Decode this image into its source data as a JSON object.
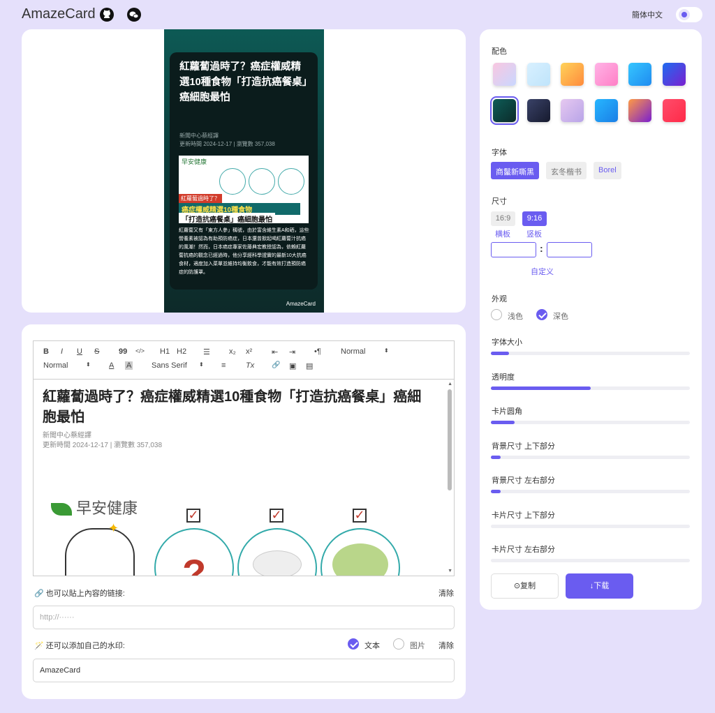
{
  "header": {
    "brand": "AmazeCard",
    "language": "簡体中文",
    "github_icon": "github-icon",
    "wechat_icon": "wechat-icon"
  },
  "preview": {
    "title": "紅蘿蔔過時了？癌症權威精選10種食物「打造抗癌餐桌」癌細胞最怕",
    "author": "新聞中心蔡經譯",
    "updated": "更新時間 2024-12-17 | 瀏覽數 357,038",
    "img_logo": "早安健康",
    "img_cap1": "紅蘿蔔過時了？",
    "img_cap2": "癌症權威精選10種食物",
    "img_cap3": "「打造抗癌餐桌」癌細胞最怕",
    "body": "紅蘿蔔又有「東方人參」稱號，由於富含維生素A和硒，這些營養素被認為有助預防癌症，日本還曾掀起喝紅蘿蔔汁抗癌的風潮！然而，日本癌症專家佐藤典宏教授認為，依賴紅蘿蔔抗癌的觀念已經過時，他分享經科學證實的最新10大抗癌食材，適度加入菜單並維持均衡飲食，才能有效打造預防癌症的防護罩。",
    "watermark": "AmazeCard"
  },
  "editor": {
    "toolbar": {
      "bold": "B",
      "italic": "I",
      "underline": "U",
      "strike": "S",
      "quote": "99",
      "code": "</>",
      "h1": "H1",
      "h2": "H2",
      "list": "☰",
      "sub": "x₂",
      "sup": "x²",
      "outdent": "⇤",
      "indent": "⇥",
      "rtl": "•¶",
      "header_select": "Normal",
      "size_select": "Normal",
      "color": "A",
      "bg": "A",
      "font_select": "Sans Serif",
      "align": "≡",
      "clean": "Tx",
      "link": "🔗",
      "image": "▣",
      "video": "▤"
    },
    "title": "紅蘿蔔過時了？癌症權威精選10種食物「打造抗癌餐桌」癌細胞最怕",
    "author": "新聞中心蔡經譯",
    "updated": "更新時間 2024-12-17 | 瀏覽數 357,038",
    "img_logo": "早安健康"
  },
  "link_section": {
    "label": "也可以貼上內容的链接:",
    "clear": "清除",
    "placeholder": "http://······"
  },
  "watermark_section": {
    "label": "还可以添加自己的水印:",
    "opt_text": "文本",
    "opt_image": "图片",
    "clear": "清除",
    "value": "AmazeCard"
  },
  "settings": {
    "color_label": "配色",
    "swatches": [
      "linear-gradient(135deg,#f9c7e0,#c9d7ff)",
      "linear-gradient(135deg,#d8f0ff,#bfe4fb)",
      "linear-gradient(135deg,#ffd35a,#ff8a3c)",
      "linear-gradient(135deg,#ffb3e6,#ff7fc6)",
      "linear-gradient(135deg,#36c6ff,#1f8bf0)",
      "linear-gradient(135deg,#1f6cf0,#7a1fd0)",
      "linear-gradient(135deg,#0e5c57,#0b2b2a)",
      "linear-gradient(135deg,#3a4268,#161a2e)",
      "linear-gradient(135deg,#e6c8f0,#b8a4e8)",
      "linear-gradient(135deg,#27b6ff,#1a7ee6)",
      "linear-gradient(135deg,#ff9a44,#7a1fd0)",
      "linear-gradient(135deg,#ff4d6b,#ff2a48)"
    ],
    "font_label": "字体",
    "fonts": [
      "商鬣新嘶黑",
      "玄冬楷书",
      "Borel"
    ],
    "size_label": "尺寸",
    "size_169": "16:9",
    "size_916": "9:16",
    "size_h": "横板",
    "size_v": "竖板",
    "custom": "自定义",
    "appearance_label": "外观",
    "light": "浅色",
    "dark": "深色",
    "sliders": [
      {
        "label": "字体大小",
        "value": 0.09
      },
      {
        "label": "透明度",
        "value": 0.5
      },
      {
        "label": "卡片圆角",
        "value": 0.12
      },
      {
        "label": "背景尺寸 上下部分",
        "value": 0.05
      },
      {
        "label": "背景尺寸 左右部分",
        "value": 0.05
      },
      {
        "label": "卡片尺寸 上下部分",
        "value": 0
      },
      {
        "label": "卡片尺寸 左右部分",
        "value": 0
      }
    ],
    "copy": "⊙复制",
    "download": "↓下载"
  },
  "colors": {
    "accent": "#6a5cf0",
    "page_bg": "#e5e0fb"
  }
}
